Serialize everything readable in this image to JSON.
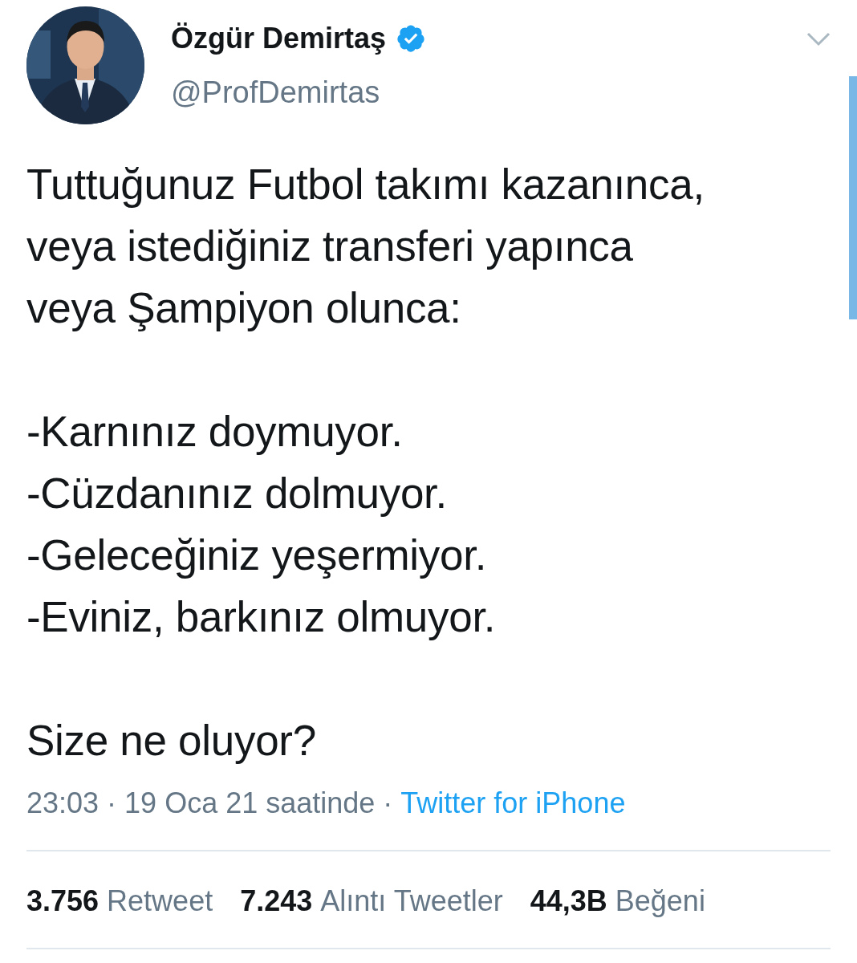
{
  "author": {
    "name": "Özgür Demirtaş",
    "verified": true,
    "handle": "@ProfDemirtas"
  },
  "tweet": {
    "text": "Tuttuğunuz Futbol takımı kazanınca,\nveya istediğiniz transferi yapınca\nveya Şampiyon olunca:\n\n-Karnınız doymuyor.\n-Cüzdanınız dolmuyor.\n-Geleceğiniz yeşermiyor.\n-Eviniz, barkınız olmuyor.\n\nSize ne oluyor?",
    "time": "23:03 · 19 Oca 21 saatinde",
    "separator": "·",
    "source": "Twitter for iPhone"
  },
  "stats": [
    {
      "count": "3.756",
      "label": "Retweet"
    },
    {
      "count": "7.243",
      "label": "Alıntı Tweetler"
    },
    {
      "count": "44,3B",
      "label": "Beğeni"
    }
  ]
}
